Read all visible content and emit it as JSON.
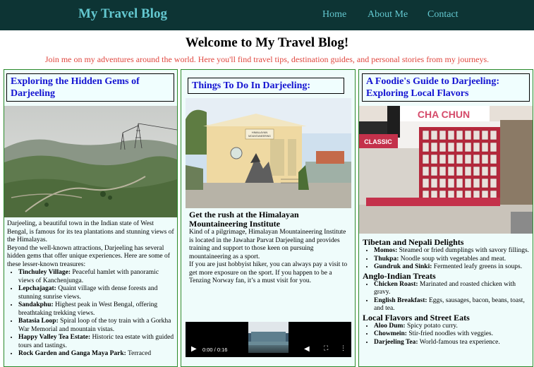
{
  "header": {
    "brand": "My Travel Blog",
    "nav": [
      "Home",
      "About Me",
      "Contact"
    ]
  },
  "hero": {
    "title": "Welcome to My Travel Blog!",
    "subtitle": "Join me on my adventures around the world. Here you'll find travel tips, destination guides, and personal stories from my journeys."
  },
  "cards": [
    {
      "title": "Exploring the Hidden Gems of Darjeeling",
      "intro": "Darjeeling, a beautiful town in the Indian state of West Bengal, is famous for its tea plantations and stunning views of the Himalayas.",
      "intro2": "Beyond the well-known attractions, Darjeeling has several hidden gems that offer unique experiences. Here are some of these lesser-known treasures:",
      "items": [
        {
          "name": "Tinchuley Village:",
          "desc": "Peaceful hamlet with panoramic views of Kanchenjunga."
        },
        {
          "name": "Lepchajagat:",
          "desc": "Quaint village with dense forests and stunning sunrise views."
        },
        {
          "name": "Sandakphu:",
          "desc": "Highest peak in West Bengal, offering breathtaking trekking views."
        },
        {
          "name": "Batasia Loop:",
          "desc": "Spiral loop of the toy train with a Gorkha War Memorial and mountain vistas."
        },
        {
          "name": "Happy Valley Tea Estate:",
          "desc": "Historic tea estate with guided tours and tastings."
        },
        {
          "name": "Rock Garden and Ganga Maya Park:",
          "desc": "Terraced"
        }
      ]
    },
    {
      "title": "Things To Do In Darjeeling:",
      "sign_text": "HIMALAYAN MOUNTAINEERING INSTITUTE",
      "heading": "Get the rush at the Himalayan Mountaineering Institute",
      "para1": "Kind of a pilgrimage, Himalayan Mountaineering Institute is located in the Jawahar Parvat Darjeeling and provides training and support to those keen on pursuing mountaineering as a sport.",
      "para2": "If you are just hobbyist hiker, you can always pay a visit to get more exposure on the sport. If you happen to be a Tenzing Norway fan, it’s a must visit for you.",
      "video_time": "0:00 / 0:16"
    },
    {
      "title": "A Foodie's Guide to Darjeeling: Exploring Local Flavors",
      "shop_sign": "CHA CHUN",
      "shop_sign2": "CLASSIC",
      "sections": [
        {
          "heading": "Tibetan and Nepali Delights",
          "items": [
            {
              "name": "Momos:",
              "desc": "Steamed or fried dumplings with savory fillings."
            },
            {
              "name": "Thukpa:",
              "desc": "Noodle soup with vegetables and meat."
            },
            {
              "name": "Gundruk and Sinki:",
              "desc": "Fermented leafy greens in soups."
            }
          ]
        },
        {
          "heading": "Anglo-Indian Treats",
          "items": [
            {
              "name": "Chicken Roast:",
              "desc": "Marinated and roasted chicken with gravy."
            },
            {
              "name": "English Breakfast:",
              "desc": "Eggs, sausages, bacon, beans, toast, and tea."
            }
          ]
        },
        {
          "heading": "Local Flavors and Street Eats",
          "items": [
            {
              "name": "Aloo Dum:",
              "desc": "Spicy potato curry."
            },
            {
              "name": "Chowmein:",
              "desc": "Stir-fried noodles with veggies."
            },
            {
              "name": "Darjeeling Tea:",
              "desc": "World-famous tea experience."
            }
          ]
        }
      ]
    }
  ]
}
